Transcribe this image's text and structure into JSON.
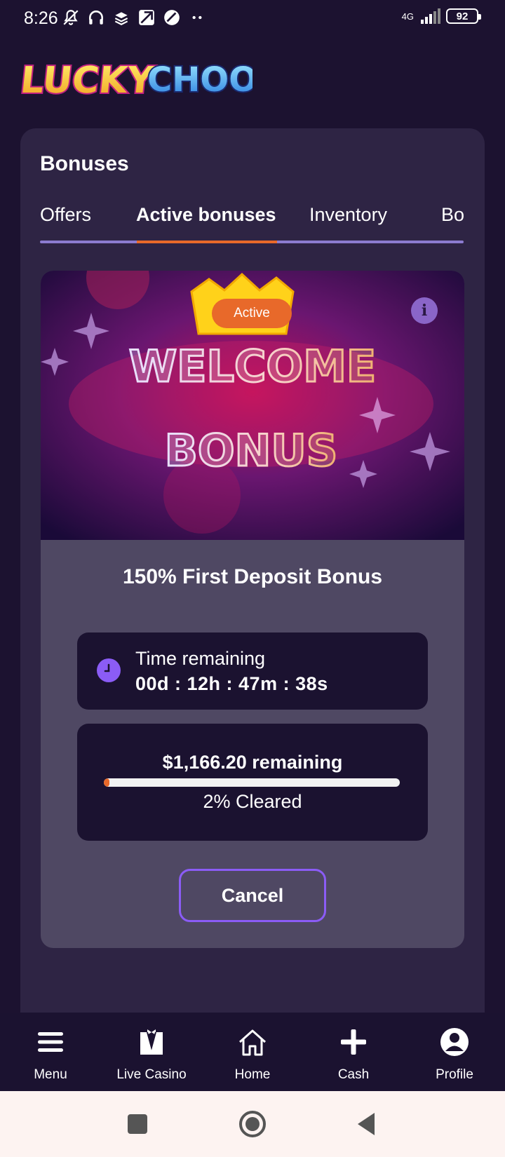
{
  "status_bar": {
    "time": "8:26",
    "network": "4G",
    "battery": "92",
    "icons": [
      "bell-off-icon",
      "headphones-icon",
      "layers-icon",
      "app-icon",
      "app2-icon",
      "more-dots-icon"
    ]
  },
  "brand": {
    "logo_text": "LuckyChoo"
  },
  "page": {
    "title": "Bonuses",
    "tabs": [
      {
        "label": "Offers",
        "active": false
      },
      {
        "label": "Active bonuses",
        "active": true
      },
      {
        "label": "Inventory",
        "active": false
      },
      {
        "label": "Bo",
        "active": false
      }
    ]
  },
  "bonus": {
    "status_badge": "Active",
    "banner_text_1": "WELCOME",
    "banner_text_2": "BONUS",
    "name": "150% First Deposit Bonus",
    "time_label": "Time remaining",
    "time_value": "00d : 12h : 47m : 38s",
    "remaining_amount": "$1,166.20 remaining",
    "cleared_percent": 2,
    "cleared_label": "2% Cleared",
    "cancel_label": "Cancel"
  },
  "bottom_nav": [
    {
      "label": "Menu",
      "icon": "menu-icon"
    },
    {
      "label": "Live Casino",
      "icon": "tuxedo-icon"
    },
    {
      "label": "Home",
      "icon": "home-icon"
    },
    {
      "label": "Cash",
      "icon": "plus-icon"
    },
    {
      "label": "Profile",
      "icon": "profile-icon"
    }
  ],
  "colors": {
    "background": "#1c1230",
    "panel": "#2e2444",
    "card": "#4f4863",
    "accent_orange": "#e8692a",
    "accent_purple": "#8b5cf6"
  }
}
